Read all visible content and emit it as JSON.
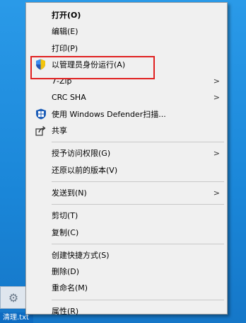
{
  "menu": {
    "group1": [
      {
        "label": "打开(O)",
        "bold": true
      },
      {
        "label": "编辑(E)"
      },
      {
        "label": "打印(P)"
      },
      {
        "label": "以管理员身份运行(A)",
        "icon": "uac-shield-icon"
      },
      {
        "label": "7-Zip",
        "submenu": true
      },
      {
        "label": "CRC SHA",
        "submenu": true
      },
      {
        "label": "使用 Windows Defender扫描...",
        "icon": "windows-defender-icon"
      },
      {
        "label": "共享",
        "icon": "share-icon"
      }
    ],
    "group2": [
      {
        "label": "授予访问权限(G)",
        "submenu": true
      },
      {
        "label": "还原以前的版本(V)"
      }
    ],
    "group3": [
      {
        "label": "发送到(N)",
        "submenu": true
      }
    ],
    "group4": [
      {
        "label": "剪切(T)"
      },
      {
        "label": "复制(C)"
      }
    ],
    "group5": [
      {
        "label": "创建快捷方式(S)"
      },
      {
        "label": "删除(D)"
      },
      {
        "label": "重命名(M)"
      }
    ],
    "group6": [
      {
        "label": "属性(R)"
      }
    ]
  },
  "desktop": {
    "file_label": "清理.txt"
  },
  "colors": {
    "highlight_border": "#e02020",
    "menu_bg": "#f0f0f0",
    "desktop_bg": "#1e90e0"
  }
}
